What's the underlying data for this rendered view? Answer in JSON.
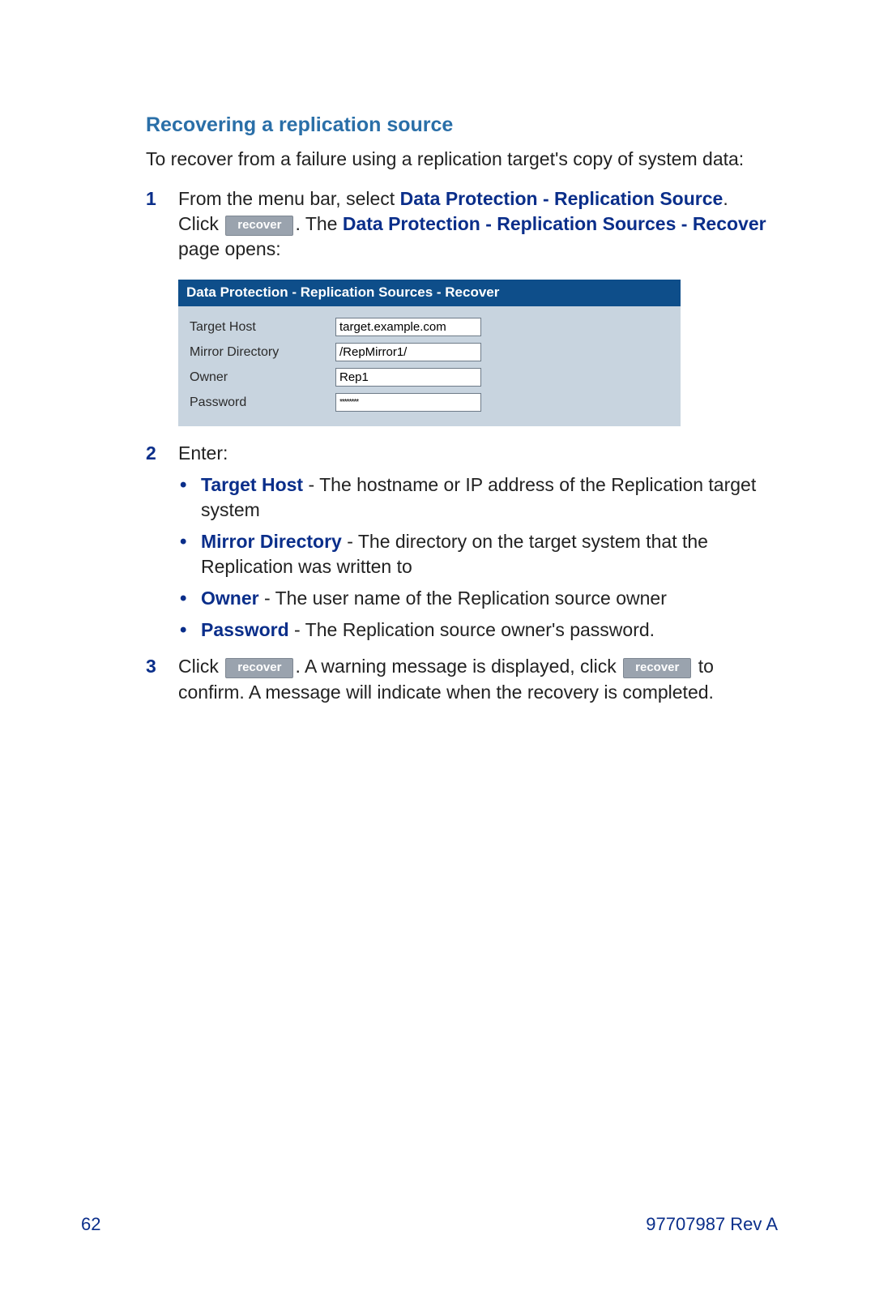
{
  "section_title": "Recovering a replication source",
  "intro": "To recover from a failure using a replication target's copy of system data:",
  "step1": {
    "a": "From the menu bar, select ",
    "b": "Data Protection - Replication Source",
    "c": ".",
    "d": "Click ",
    "btn": "recover",
    "e": ". The ",
    "f": "Data Protection - Replication Sources - Recover",
    "g": " page opens:"
  },
  "form": {
    "title": "Data Protection - Replication Sources - Recover",
    "rows": [
      {
        "label": "Target Host",
        "value": "target.example.com"
      },
      {
        "label": "Mirror Directory",
        "value": "/RepMirror1/"
      },
      {
        "label": "Owner",
        "value": "Rep1"
      },
      {
        "label": "Password",
        "value": "********"
      }
    ]
  },
  "step2": {
    "lead": "Enter:",
    "bullets": [
      {
        "term": "Target Host",
        "desc": " - The hostname or IP address of the Replication target system"
      },
      {
        "term": "Mirror Directory",
        "desc": " - The directory on the target system that the Replication was written to"
      },
      {
        "term": "Owner",
        "desc": " - The user name of the Replication source owner"
      },
      {
        "term": "Password",
        "desc": " - The Replication source owner's password."
      }
    ]
  },
  "step3": {
    "a": "Click ",
    "btn1": "recover",
    "b": ". A warning message is displayed, click ",
    "btn2": "recover",
    "c": " to confirm. A message will indicate when the recovery is completed."
  },
  "footer": {
    "page": "62",
    "doc": "97707987 Rev A"
  }
}
